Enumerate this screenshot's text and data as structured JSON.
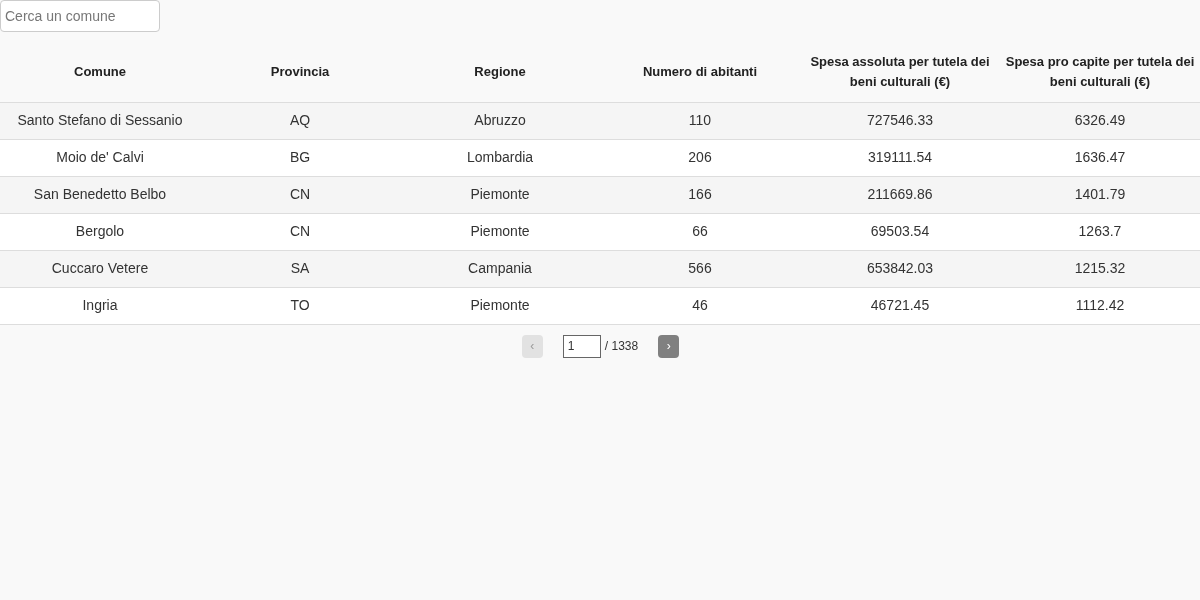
{
  "search": {
    "placeholder": "Cerca un comune"
  },
  "table": {
    "columns": [
      "Comune",
      "Provincia",
      "Regione",
      "Numero di abitanti",
      "Spesa assoluta per tutela dei beni culturali (€)",
      "Spesa pro capite per tutela dei beni culturali (€)"
    ],
    "rows": [
      [
        "Santo Stefano di Sessanio",
        "AQ",
        "Abruzzo",
        "110",
        "727546.33",
        "6326.49"
      ],
      [
        "Moio de' Calvi",
        "BG",
        "Lombardia",
        "206",
        "319111.54",
        "1636.47"
      ],
      [
        "San Benedetto Belbo",
        "CN",
        "Piemonte",
        "166",
        "211669.86",
        "1401.79"
      ],
      [
        "Bergolo",
        "CN",
        "Piemonte",
        "66",
        "69503.54",
        "1263.7"
      ],
      [
        "Cuccaro Vetere",
        "SA",
        "Campania",
        "566",
        "653842.03",
        "1215.32"
      ],
      [
        "Ingria",
        "TO",
        "Piemonte",
        "46",
        "46721.45",
        "1112.42"
      ]
    ]
  },
  "pagination": {
    "prev": {
      "label": "‹",
      "disabled": true
    },
    "page": "1",
    "total": "/ 1338",
    "next": {
      "label": "›",
      "disabled": false
    }
  }
}
